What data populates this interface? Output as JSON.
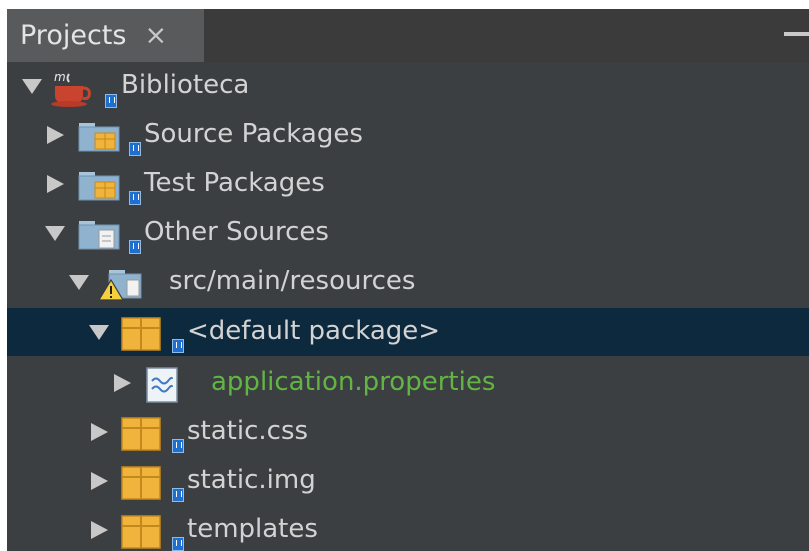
{
  "panel": {
    "tab_title": "Projects",
    "close_glyph": "×"
  },
  "tree": {
    "nodes": [
      {
        "label": "Biblioteca",
        "icon": "maven-project-icon",
        "expanded": true
      },
      {
        "label": "Source Packages",
        "icon": "source-packages-folder-icon",
        "expanded": false
      },
      {
        "label": "Test Packages",
        "icon": "test-packages-folder-icon",
        "expanded": false
      },
      {
        "label": "Other Sources",
        "icon": "other-sources-folder-icon",
        "expanded": true
      },
      {
        "label": "src/main/resources",
        "icon": "resources-folder-warning-icon",
        "expanded": true
      },
      {
        "label": "<default package>",
        "icon": "package-icon",
        "expanded": true,
        "selected": true
      },
      {
        "label": "application.properties",
        "icon": "properties-file-icon",
        "expanded": false
      },
      {
        "label": "static.css",
        "icon": "package-icon",
        "expanded": false
      },
      {
        "label": "static.img",
        "icon": "package-icon",
        "expanded": false
      },
      {
        "label": "templates",
        "icon": "package-icon",
        "expanded": false
      }
    ]
  },
  "colors": {
    "panel_bg": "#3c3f41",
    "selection_bg": "#0d293e",
    "text": "#d3d3d3",
    "modified_file_text": "#62b543",
    "tab_bg": "#585a5c"
  }
}
